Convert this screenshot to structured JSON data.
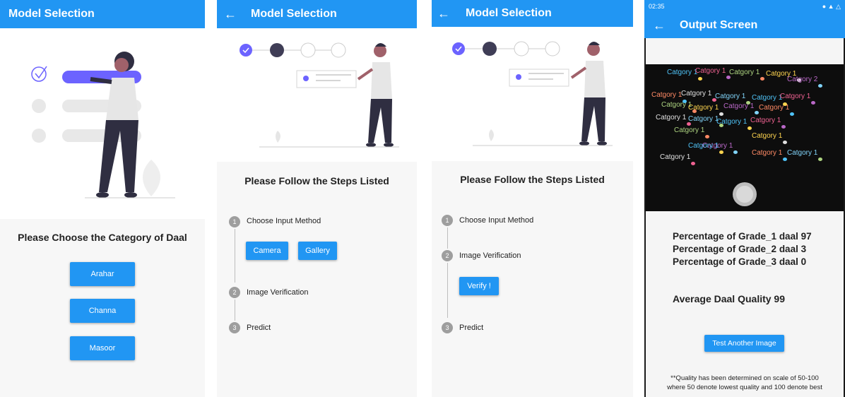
{
  "screen1": {
    "title": "Model Selection",
    "heading": "Please Choose the Category of Daal",
    "buttons": [
      "Arahar",
      "Channa",
      "Masoor"
    ]
  },
  "screen2": {
    "title": "Model Selection",
    "heading": "Please Follow the Steps Listed",
    "steps": [
      {
        "num": "1",
        "label": "Choose Input Method"
      },
      {
        "num": "2",
        "label": "Image Verification"
      },
      {
        "num": "3",
        "label": "Predict"
      }
    ],
    "camera_label": "Camera",
    "gallery_label": "Gallery",
    "stepper_current": 2,
    "stepper_total": 4
  },
  "screen3": {
    "title": "Model Selection",
    "heading": "Please Follow the Steps Listed",
    "steps": [
      {
        "num": "1",
        "label": "Choose Input Method"
      },
      {
        "num": "2",
        "label": "Image Verification"
      },
      {
        "num": "3",
        "label": "Predict"
      }
    ],
    "verify_label": "Verify !",
    "stepper_current": 2,
    "stepper_total": 4
  },
  "screen4": {
    "status_time": "02:35",
    "title": "Output Screen",
    "detection_label": "Catgory 1",
    "detection_label_2": "Catgory 2",
    "results": [
      "Percentage of Grade_1 daal 97",
      "Percentage of Grade_2 daal 3",
      "Percentage of Grade_3 daal 0"
    ],
    "average": "Average Daal Quality 99",
    "test_button": "Test Another Image",
    "note_line1": "**Quality has been determined on scale of 50-100",
    "note_line2": "where 50 denote lowest quality and 100 denote best"
  },
  "colors": {
    "primary": "#2196f3",
    "step_done": "#6c63ff",
    "step_current": "#3f3d56",
    "step_pending": "#ffffff"
  },
  "icons": [
    "back-arrow-icon",
    "check-icon"
  ]
}
